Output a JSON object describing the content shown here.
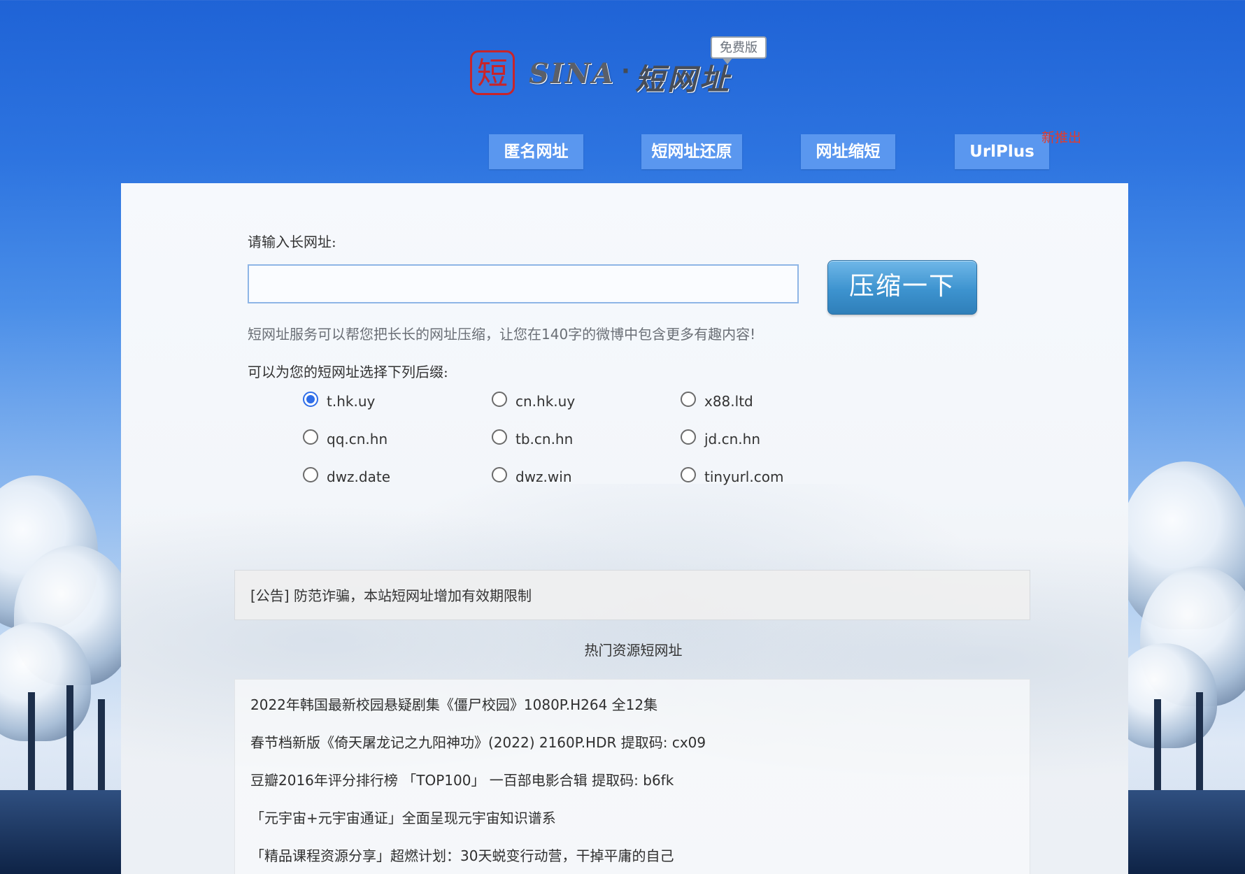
{
  "header": {
    "logo_seal": "短",
    "logo_sina": "SINA",
    "logo_dot": "·",
    "logo_cn": "短网址",
    "logo_badge": "免费版"
  },
  "nav": {
    "items": [
      {
        "label": "匿名网址"
      },
      {
        "label": "短网址还原"
      },
      {
        "label": "网址缩短"
      },
      {
        "label": "UrlPlus"
      }
    ],
    "new_tag": "新推出"
  },
  "form": {
    "long_url_label": "请输入长网址:",
    "input_value": "",
    "input_placeholder": "",
    "submit_label": "压缩一下",
    "hint": "短网址服务可以帮您把长长的网址压缩，让您在140字的微博中包含更多有趣内容!",
    "suffix_label": "可以为您的短网址选择下列后缀:",
    "suffixes": [
      {
        "label": "t.hk.uy",
        "checked": true
      },
      {
        "label": "cn.hk.uy",
        "checked": false
      },
      {
        "label": "x88.ltd",
        "checked": false
      },
      {
        "label": "qq.cn.hn",
        "checked": false
      },
      {
        "label": "tb.cn.hn",
        "checked": false
      },
      {
        "label": "jd.cn.hn",
        "checked": false
      },
      {
        "label": "dwz.date",
        "checked": false
      },
      {
        "label": "dwz.win",
        "checked": false
      },
      {
        "label": "tinyurl.com",
        "checked": false
      }
    ]
  },
  "notice": {
    "text": "[公告] 防范诈骗，本站短网址增加有效期限制"
  },
  "hot": {
    "title": "热门资源短网址",
    "items": [
      "2022年韩国最新校园悬疑剧集《僵尸校园》1080P.H264 全12集",
      "春节档新版《倚天屠龙记之九阳神功》(2022) 2160P.HDR    提取码: cx09",
      "豆瓣2016年评分排行榜 「TOP100」 一百部电影合辑    提取码: b6fk",
      "「元宇宙+元宇宙通证」全面呈现元宇宙知识谱系",
      "「精品课程资源分享」超燃计划：30天蜕变行动营，干掉平庸的自己"
    ]
  },
  "colors": {
    "nav_button": "#5a97ef",
    "new_tag": "#e23c2c",
    "radio_checked": "#2f6ee8",
    "submit_button": "#3d93cf"
  }
}
